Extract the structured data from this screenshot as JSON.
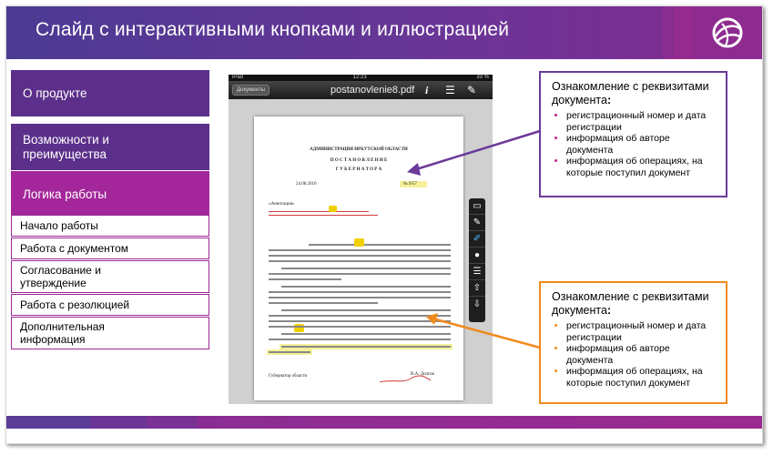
{
  "header": {
    "title": "Слайд с интерактивными кнопками и иллюстрацией"
  },
  "sidebar": {
    "main_items": [
      {
        "label": "О продукте"
      },
      {
        "label": "Возможности и преимущества"
      },
      {
        "label": "Логика работы"
      }
    ],
    "sub_items": [
      {
        "label": "Начало работы"
      },
      {
        "label": "Работа с документом"
      },
      {
        "label": "Согласование и утверждение"
      },
      {
        "label": "Работа с резолюцией"
      },
      {
        "label": "Дополнительная информация"
      }
    ]
  },
  "device": {
    "status_left": "iPad",
    "status_time": "12:23",
    "status_right": "33 %",
    "docs_button": "Документы",
    "doc_title": "postanovlenie8.pdf"
  },
  "document": {
    "org": "АДМИНИСТРАЦИЯ ИРКУТСКОЙ ОБЛАСТИ",
    "heading1": "П О С Т А Н О В Л Е Н И Е",
    "heading2": "Г У Б Е Р Н А Т О Р А",
    "date": "24.08.2010",
    "number": "№ 9/57",
    "subject": "«Аннотация»",
    "signer_title": "Губернатор области",
    "signer_name": "В.А. Долгов"
  },
  "callout_top": {
    "title": "Ознакомление с реквизитами документа",
    "title_suffix": ":",
    "items": [
      "регистрационный номер и дата регистрации",
      "информация об авторе документа",
      "информация об операциях, на которые поступил документ"
    ]
  },
  "callout_bottom": {
    "title": "Ознакомление с реквизитами документа",
    "title_suffix": ":",
    "items": [
      "регистрационный номер и дата регистрации",
      "информация об авторе документа",
      "информация об операциях, на которые поступил документ"
    ]
  },
  "colors": {
    "purple_dark": "#5b2f8a",
    "magenta": "#a3279a",
    "callout_top_border": "#6b3a9a",
    "callout_bottom_border": "#f08a1c",
    "bullet_top": "#c0208f",
    "bullet_bottom": "#f08a1c"
  },
  "icons": {
    "logo": "globe-swirl-logo",
    "info": "info-icon",
    "list": "list-icon",
    "edit": "edit-icon",
    "tools": [
      "comment-icon",
      "pen-icon",
      "marker-icon",
      "microphone-icon",
      "checklist-icon",
      "forward-comment-icon",
      "back-comment-icon"
    ]
  }
}
